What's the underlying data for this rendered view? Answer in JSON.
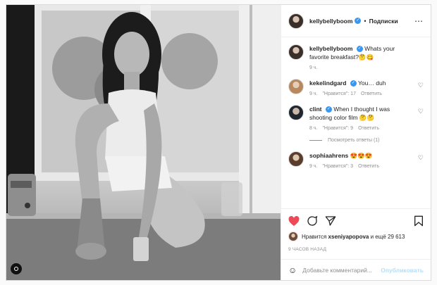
{
  "header": {
    "username": "kellybellyboom",
    "follow_label": "Подписки",
    "separator": "•",
    "more_icon": "ellipsis-icon"
  },
  "caption": {
    "username": "kellybellyboom",
    "text": "Whats your favorite breakfast?🤔😋",
    "time": "9 ч."
  },
  "comments": [
    {
      "username": "kekelindgard",
      "text": "You… duh",
      "time": "9 ч.",
      "likes": "\"Нравится\": 17",
      "reply": "Ответить"
    },
    {
      "username": "clint",
      "text": "When I thought I was shooting color film 🤔🤔",
      "time": "8 ч.",
      "likes": "\"Нравится\": 9",
      "reply": "Ответить",
      "view_replies": "Посмотреть ответы (1)"
    },
    {
      "username": "sophiaahrens",
      "text": "😍😍😍",
      "time": "9 ч.",
      "likes": "\"Нравится\": 3",
      "reply": "Ответить"
    }
  ],
  "actions": {
    "liked": true,
    "likes_prefix": "Нравится",
    "likes_user": "xseniyapopova",
    "likes_suffix": "и ещё 29 613",
    "ago": "9 ЧАСОВ НАЗАД"
  },
  "add_comment": {
    "placeholder": "Добавьте комментарий...",
    "post_label": "Опубликовать"
  },
  "colors": {
    "heart": "#ed4956",
    "verified": "#3897f0",
    "post_disabled": "#b2dffc"
  }
}
